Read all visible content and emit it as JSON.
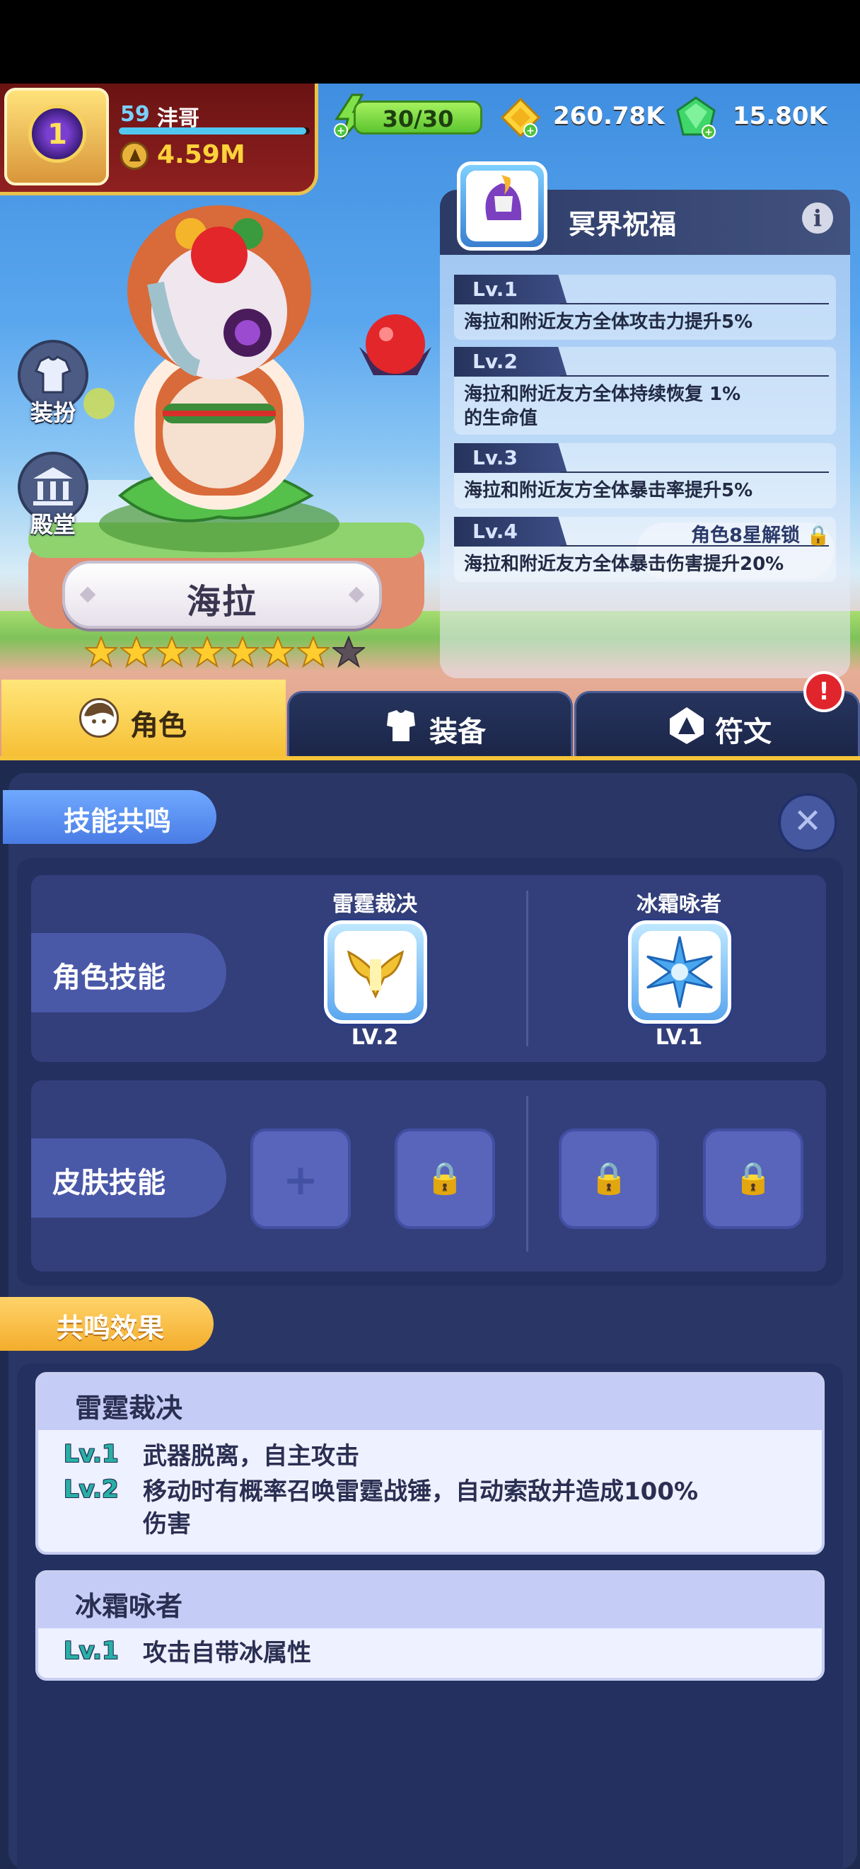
{
  "header": {
    "player_level": "59",
    "player_name": "沣哥",
    "xp_fraction": 0.98,
    "power": "4.59M",
    "energy": "30/30",
    "gold": "260.78K",
    "gems": "15.80K",
    "avatar_rank": "1"
  },
  "side_buttons": {
    "dress_up": "装扮",
    "hall": "殿堂"
  },
  "hero": {
    "name": "海拉",
    "stars_filled": 7,
    "stars_total": 8
  },
  "blessing": {
    "title": "冥界祝福",
    "levels": [
      {
        "tag": "Lv.1",
        "desc": "海拉和附近友方全体攻击力提升5%",
        "lock": ""
      },
      {
        "tag": "Lv.2",
        "desc": "海拉和附近友方全体持续恢复 1%\n的生命值",
        "lock": ""
      },
      {
        "tag": "Lv.3",
        "desc": "海拉和附近友方全体暴击率提升5%",
        "lock": ""
      },
      {
        "tag": "Lv.4",
        "desc": "海拉和附近友方全体暴击伤害提升20%",
        "lock": "角色8星解锁"
      }
    ]
  },
  "tabs": {
    "role": "角色",
    "equipment": "装备",
    "rune": "符文",
    "alert": "!"
  },
  "resonance": {
    "title": "技能共鸣",
    "role_skill_label": "角色技能",
    "skin_skill_label": "皮肤技能",
    "skills": [
      {
        "name": "雷霆裁决",
        "level": "LV.2"
      },
      {
        "name": "冰霜咏者",
        "level": "LV.1"
      }
    ],
    "slot_add": "+",
    "slot_locked": "🔒"
  },
  "effects": {
    "title": "共鸣效果",
    "cards": [
      {
        "name": "雷霆裁决",
        "rows": [
          {
            "lv": "Lv.1",
            "desc": "武器脱离，自主攻击"
          },
          {
            "lv": "Lv.2",
            "desc": "移动时有概率召唤雷霆战锤，自动索敌并造成100%\n伤害"
          }
        ]
      },
      {
        "name": "冰霜咏者",
        "rows": [
          {
            "lv": "Lv.1",
            "desc": "攻击自带冰属性"
          }
        ]
      }
    ]
  },
  "colors": {
    "accent_gold": "#f6c43a",
    "panel_navy": "#243060",
    "skill_level_teal": "#29b0a5"
  }
}
